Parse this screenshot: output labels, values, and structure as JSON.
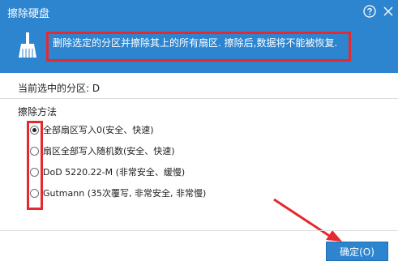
{
  "window": {
    "title": "擦除硬盘"
  },
  "banner": {
    "message": "删除选定的分区并擦除其上的所有扇区. 擦除后,数据将不能被恢复."
  },
  "partition": {
    "label": "当前选中的分区: D"
  },
  "wipe": {
    "method_label": "擦除方法",
    "options": [
      {
        "label": "全部扇区写入0(安全、快速)",
        "checked": true
      },
      {
        "label": "扇区全部写入随机数(安全、快速)",
        "checked": false
      },
      {
        "label": "DoD 5220.22-M (非常安全、缓慢)",
        "checked": false
      },
      {
        "label": "Gutmann (35次覆写, 非常安全, 非常慢)",
        "checked": false
      }
    ]
  },
  "buttons": {
    "ok": "确定(O)"
  },
  "icons": {
    "help": "help-icon",
    "close": "close-icon",
    "broom": "broom-icon"
  },
  "colors": {
    "accent": "#2d85cf",
    "annotation": "#e5292e"
  }
}
